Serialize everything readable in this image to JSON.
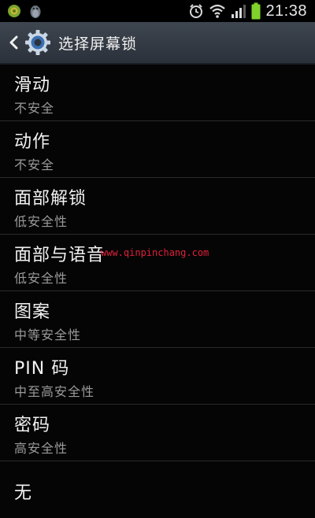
{
  "status_bar": {
    "time": "21:38",
    "icons": [
      "android-badge-icon",
      "qq-penguin-icon",
      "alarm-icon",
      "wifi-icon",
      "signal-icon",
      "battery-icon"
    ]
  },
  "action_bar": {
    "title": "选择屏幕锁",
    "back_icon": "chevron-left-icon",
    "app_icon": "settings-gear-icon"
  },
  "options": [
    {
      "title": "滑动",
      "subtitle": "不安全"
    },
    {
      "title": "动作",
      "subtitle": "不安全"
    },
    {
      "title": "面部解锁",
      "subtitle": "低安全性"
    },
    {
      "title": "面部与语音",
      "subtitle": "低安全性"
    },
    {
      "title": "图案",
      "subtitle": "中等安全性"
    },
    {
      "title": "PIN 码",
      "subtitle": "中至高安全性"
    },
    {
      "title": "密码",
      "subtitle": "高安全性"
    },
    {
      "title": "无",
      "subtitle": ""
    }
  ],
  "watermark": "www.qinpinchang.com",
  "colors": {
    "background": "#050505",
    "action_bar": "#363d46",
    "battery": "#7fd22b",
    "watermark": "#e0203a"
  }
}
